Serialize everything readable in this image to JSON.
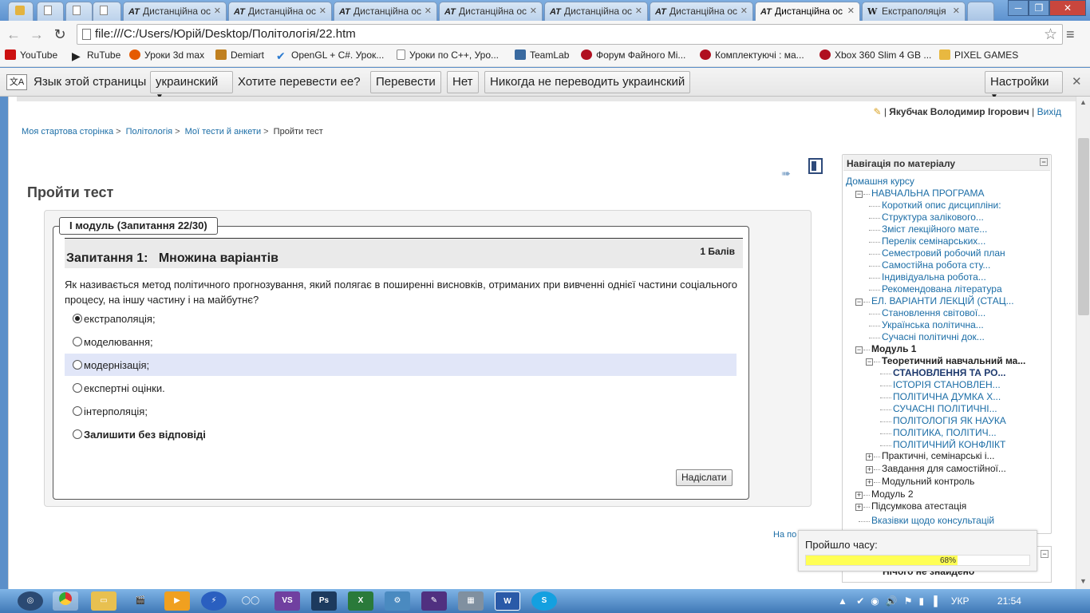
{
  "browser": {
    "tabs": [
      {
        "label": "Дистанційна ос",
        "icon": "AT"
      },
      {
        "label": "Дистанційна ос",
        "icon": "AT"
      },
      {
        "label": "Дистанційна ос",
        "icon": "AT"
      },
      {
        "label": "Дистанційна ос",
        "icon": "AT"
      },
      {
        "label": "Дистанційна ос",
        "icon": "AT"
      },
      {
        "label": "Дистанційна ос",
        "icon": "AT"
      },
      {
        "label": "Дистанційна ос",
        "icon": "AT"
      },
      {
        "label": "Екстраполяція",
        "icon": "W"
      }
    ],
    "address": "file:///C:/Users/Юрій/Desktop/Політологія/22.htm",
    "bookmarks": [
      {
        "label": "YouTube",
        "icon": "youtube-icon",
        "color": "#cc1111"
      },
      {
        "label": "RuTube",
        "icon": "rutube-icon",
        "color": "#222222"
      },
      {
        "label": "Уроки 3d max",
        "icon": "3dmax-icon",
        "color": "#e55a00"
      },
      {
        "label": "Demiart",
        "icon": "demiart-icon",
        "color": "#c08020"
      },
      {
        "label": "OpenGL + C#. Урок...",
        "icon": "check-icon",
        "color": "#2a7ad0"
      },
      {
        "label": "Уроки по C++, Уро...",
        "icon": "page-icon",
        "color": "#888888"
      },
      {
        "label": "TeamLab",
        "icon": "teamlab-icon",
        "color": "#3a6aa0"
      },
      {
        "label": "Форум Файного Мі...",
        "icon": "forum-icon",
        "color": "#b01020"
      },
      {
        "label": "Комплектуючі : ма...",
        "icon": "forum-icon",
        "color": "#b01020"
      },
      {
        "label": "Xbox 360 Slim 4 GB ...",
        "icon": "forum-icon",
        "color": "#b01020"
      },
      {
        "label": "PIXEL GAMES",
        "icon": "folder-icon",
        "color": "#e8b840"
      }
    ],
    "translate": {
      "prompt": "Язык этой страницы",
      "language": "украинский",
      "question": "Хотите перевести ее?",
      "translate_btn": "Перевести",
      "no_btn": "Нет",
      "never_btn": "Никогда не переводить украинский",
      "settings_btn": "Настройки"
    }
  },
  "page": {
    "user": "Якубчак Володимир Ігорович",
    "logout": "Вихід",
    "breadcrumbs": [
      "Моя стартова сторінка",
      "Політологія",
      "Мої тести й анкети",
      "Пройти тест"
    ],
    "title": "Пройти тест",
    "legend": "І модуль (Запитання 22/30)",
    "question_title": "Запитання 1:   Множина варіантів",
    "points": "1 Балів",
    "question_text": "Як називається метод політичного прогнозування, який полягає в поширенні висновків, отриманих при вивченні однієї частини соціального процесу, на іншу частину і на майбутнє?",
    "answers": [
      {
        "label": "екстраполяція;",
        "selected": true,
        "highlight": false
      },
      {
        "label": "моделювання;",
        "selected": false,
        "highlight": false
      },
      {
        "label": "модернізація;",
        "selected": false,
        "highlight": true
      },
      {
        "label": "експертні оцінки.",
        "selected": false,
        "highlight": false
      },
      {
        "label": "інтерполяція;",
        "selected": false,
        "highlight": false
      },
      {
        "label": "Залишити без відповіді",
        "selected": false,
        "highlight": false,
        "bold": true
      }
    ],
    "submit": "Надіслати",
    "footer_link": "На по",
    "nav": {
      "title": "Навігація по матеріалу",
      "home": "Домашня курсу",
      "items": [
        {
          "label": "НАВЧАЛЬНА ПРОГРАМА",
          "level": 1,
          "toggle": "-"
        },
        {
          "label": "Короткий опис дисципліни:",
          "level": 2
        },
        {
          "label": "Структура залікового...",
          "level": 2
        },
        {
          "label": "Зміст лекційного мате...",
          "level": 2
        },
        {
          "label": "Перелік семінарських...",
          "level": 2,
          "green": true
        },
        {
          "label": "Семестровий робочий план",
          "level": 2
        },
        {
          "label": "Самостійна робота сту...",
          "level": 2
        },
        {
          "label": "Індивідуальна робота...",
          "level": 2
        },
        {
          "label": "Рекомендована література",
          "level": 2
        },
        {
          "label": "ЕЛ. ВАРІАНТИ ЛЕКЦІЙ (СТАЦ...",
          "level": 1,
          "toggle": "-"
        },
        {
          "label": "Становлення світової...",
          "level": 2,
          "green": true
        },
        {
          "label": "Українська політична...",
          "level": 2
        },
        {
          "label": "Сучасні політичні док...",
          "level": 2
        },
        {
          "label": "Модуль 1",
          "level": 1,
          "toggle": "-",
          "bold": true
        },
        {
          "label": "Теоретичний навчальний ма...",
          "level": 2,
          "toggle": "-",
          "bold": true
        },
        {
          "label": "СТАНОВЛЕННЯ ТА РО...",
          "level": 3,
          "dark": true
        },
        {
          "label": "ІСТОРІЯ СТАНОВЛЕН...",
          "level": 3
        },
        {
          "label": "ПОЛІТИЧНА ДУМКА Х...",
          "level": 3
        },
        {
          "label": "СУЧАСНІ ПОЛІТИЧНІ...",
          "level": 3
        },
        {
          "label": "ПОЛІТОЛОГІЯ ЯК НАУКА",
          "level": 3,
          "green": true
        },
        {
          "label": "ПОЛІТИКА, ПОЛІТИЧ...",
          "level": 3
        },
        {
          "label": "ПОЛІТИЧНИЙ КОНФЛІКТ",
          "level": 3
        },
        {
          "label": "Практичні, семінарські і...",
          "level": 2,
          "toggle": "+",
          "black": true
        },
        {
          "label": "Завдання для самостійної...",
          "level": 2,
          "toggle": "+",
          "black": true
        },
        {
          "label": "Модульний контроль",
          "level": 2,
          "toggle": "+",
          "black": true
        },
        {
          "label": "Модуль 2",
          "level": 1,
          "toggle": "+",
          "black": true
        },
        {
          "label": "Підсумкова атестація",
          "level": 1,
          "toggle": "+",
          "black": true
        },
        {
          "label": "Вказівки щодо консультацій",
          "level": 1
        }
      ],
      "second_block_text": "Нічого не знайдено"
    },
    "timer": {
      "label": "Пройшло часу:",
      "percent": 68,
      "percent_label": "68%"
    }
  },
  "taskbar": {
    "apps": [
      "Пуск",
      "Chrome",
      "Провідник",
      "Відео",
      "Медіа",
      "Aimp",
      "Mask",
      "Visual Studio",
      "Photoshop",
      "Excel",
      "Налаштування",
      "Маркер",
      "Калькулятор",
      "Word",
      "Skype"
    ],
    "lang": "УКР",
    "time": "21:54"
  }
}
